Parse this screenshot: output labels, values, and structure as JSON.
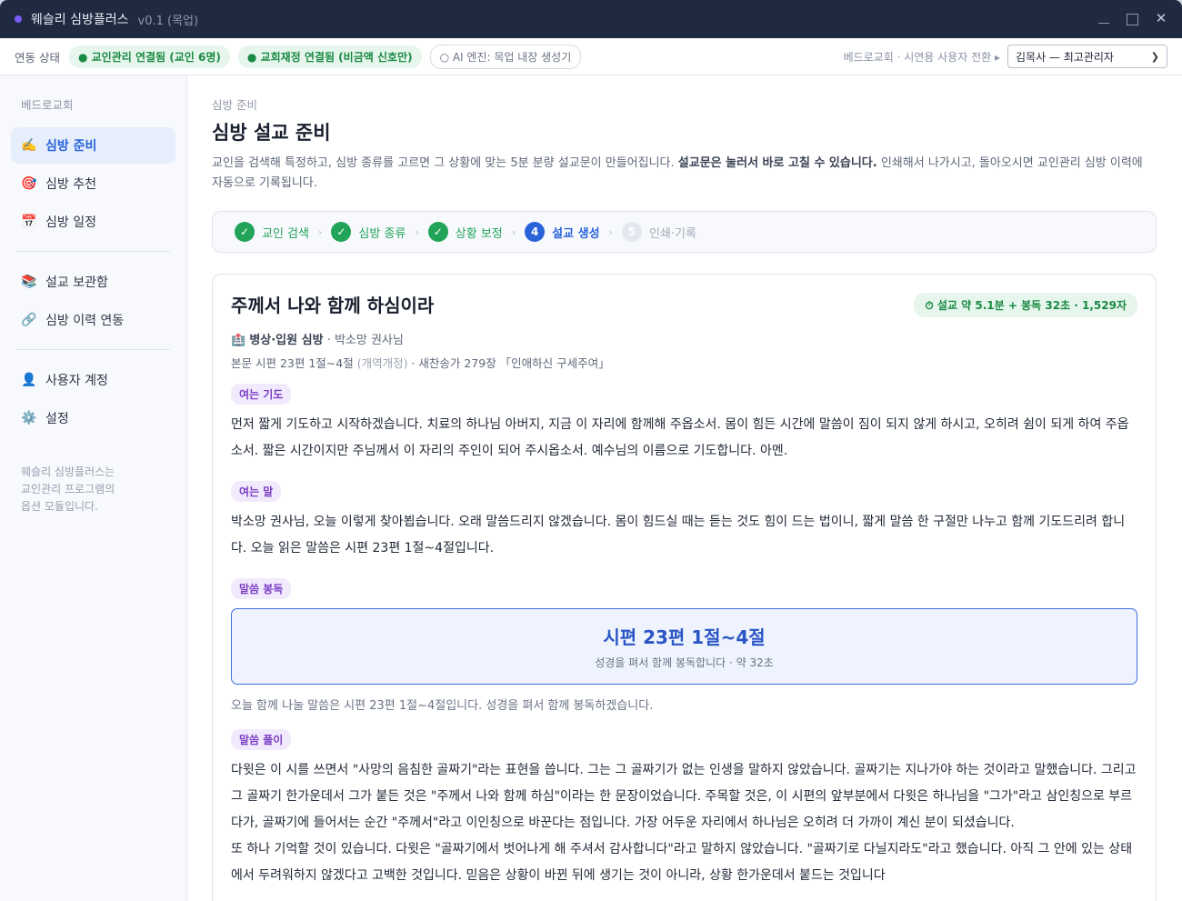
{
  "app": {
    "name": "웨슬리 심방플러스",
    "version": "v0.1 (목업)",
    "close_glyph": "✕"
  },
  "status": {
    "label": "연동 상태",
    "pills": [
      "● 교인관리 연결됨 (교인 6명)",
      "● 교회재정 연결됨 (비금액 신호만)",
      "○ AI 엔진: 목업 내장 생성기"
    ],
    "context": "베드로교회 · 시연용 사용자 전환 ▸",
    "user": "김목사 — 최고관리자"
  },
  "sidebar": {
    "church": "베드로교회",
    "items": [
      {
        "label": "심방 준비",
        "icon": "writing-hand-icon",
        "glyph": "✍️"
      },
      {
        "label": "심방 추천",
        "icon": "target-icon",
        "glyph": "🎯"
      },
      {
        "label": "심방 일정",
        "icon": "calendar-icon",
        "glyph": "📅"
      },
      {
        "label": "설교 보관함",
        "icon": "books-icon",
        "glyph": "📚"
      },
      {
        "label": "심방 이력 연동",
        "icon": "link-icon",
        "glyph": "🔗"
      },
      {
        "label": "사용자 계정",
        "icon": "user-icon",
        "glyph": "👤"
      },
      {
        "label": "설정",
        "icon": "gear-icon",
        "glyph": "⚙️"
      }
    ],
    "note_lines": [
      "웨슬리 심방플러스는",
      "교인관리 프로그램의",
      "옵션 모듈입니다."
    ]
  },
  "page": {
    "crumb": "심방 준비",
    "title": "심방 설교 준비",
    "desc_1": "교인을 검색해 특정하고, 심방 종류를 고르면 그 상황에 맞는 5분 분량 설교문이 만들어집니다. ",
    "desc_bold": "설교문은 눌러서 바로 고칠 수 있습니다.",
    "desc_2": " 인쇄해서 나가시고, 돌아오시면 교인관리 심방 이력에 자동으로 기록됩니다."
  },
  "steps": [
    {
      "num": "✓",
      "label": "교인 검색",
      "state": "done"
    },
    {
      "num": "✓",
      "label": "심방 종류",
      "state": "done"
    },
    {
      "num": "✓",
      "label": "상황 보정",
      "state": "done"
    },
    {
      "num": "4",
      "label": "설교 생성",
      "state": "current"
    },
    {
      "num": "5",
      "label": "인쇄·기록",
      "state": "todo"
    }
  ],
  "step_sep": "›",
  "sermon": {
    "title": "주께서 나와 함께 하심이라",
    "time_badge": "⏱ 설교 약 5.1분 + 봉독 32초 · 1,529자",
    "type_icon": "🏥",
    "type": "병상·입원 심방",
    "person": " · 박소망 권사님",
    "text_prefix": "본문 시편 23편 1절~4절 ",
    "text_version": "(개역개정)",
    "text_hymn": " · 새찬송가 279장 「인애하신 구세주여」",
    "sections": {
      "opening_prayer": {
        "tag": "여는 기도",
        "body": "먼저 짧게 기도하고 시작하겠습니다. 치료의 하나님 아버지, 지금 이 자리에 함께해 주옵소서. 몸이 힘든 시간에 말씀이 짐이 되지 않게 하시고, 오히려 쉼이 되게 하여 주옵소서. 짧은 시간이지만 주님께서 이 자리의 주인이 되어 주시옵소서. 예수님의 이름으로 기도합니다. 아멘."
      },
      "opening_words": {
        "tag": "여는 말",
        "body": "박소망 권사님, 오늘 이렇게 찾아뵙습니다. 오래 말씀드리지 않겠습니다. 몸이 힘드실 때는 듣는 것도 힘이 드는 법이니, 짧게 말씀 한 구절만 나누고 함께 기도드리려 합니다. 오늘 읽은 말씀은 시편 23편 1절~4절입니다."
      },
      "reading": {
        "tag": "말씀 봉독",
        "ref": "시편 23편 1절~4절",
        "sub": "성경을 펴서 함께 봉독합니다 · 약 32초",
        "note": "오늘 함께 나눌 말씀은 시편 23편 1절~4절입니다. 성경을 펴서 함께 봉독하겠습니다."
      },
      "exposition": {
        "tag": "말씀 풀이",
        "body1": "다윗은 이 시를 쓰면서 \"사망의 음침한 골짜기\"라는 표현을 씁니다. 그는 그 골짜기가 없는 인생을 말하지 않았습니다. 골짜기는 지나가야 하는 것이라고 말했습니다. 그리고 그 골짜기 한가운데서 그가 붙든 것은 \"주께서 나와 함께 하심\"이라는 한 문장이었습니다. 주목할 것은, 이 시편의 앞부분에서 다윗은 하나님을 \"그가\"라고 삼인칭으로 부르다가, 골짜기에 들어서는 순간 \"주께서\"라고 이인칭으로 바꾼다는 점입니다. 가장 어두운 자리에서 하나님은 오히려 더 가까이 계신 분이 되셨습니다.",
        "body2": "또 하나 기억할 것이 있습니다. 다윗은 \"골짜기에서 벗어나게 해 주셔서 감사합니다\"라고 말하지 않았습니다. \"골짜기로 다닐지라도\"라고 했습니다. 아직 그 안에 있는 상태에서 두려워하지 않겠다고 고백한 것입니다. 믿음은 상황이 바뀐 뒤에 생기는 것이 아니라, 상황 한가운데서 붙드는 것입니다"
      }
    }
  }
}
